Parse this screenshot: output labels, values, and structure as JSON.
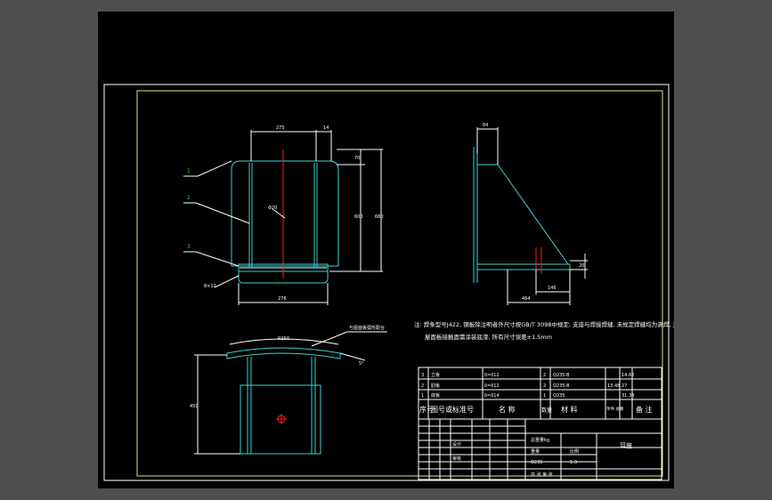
{
  "drawing": {
    "note_line1": "注: 焊条型号J422, 钢板除注明者外尺寸按GB/T 3098中规定, 支座与焊接焊缝, 未规定焊缝均为满焊,  支座与",
    "note_line2": "屋面板接触面需涂装底漆, 所有尺寸误差±1.5mm",
    "front_view": {
      "dim_top_left": "275",
      "dim_top_right": "14",
      "dim_right_small": "70",
      "dim_right_mid": "600",
      "dim_right_total": "680",
      "dim_bottom": "276",
      "label_center": "Φ20",
      "label_bottom_left": "8×12",
      "part_markers": [
        "1",
        "2",
        "3"
      ]
    },
    "side_view": {
      "dim_top": "64",
      "dim_right": "20",
      "dim_bottom_inner": "146",
      "dim_bottom": "464"
    },
    "plan_view": {
      "dim_arc": "R250",
      "label_leader": "与屋面板弧形配合",
      "dim_left": "450",
      "dim_angle": "5°"
    },
    "bom": {
      "rows": [
        {
          "no": "3",
          "name": "立板",
          "spec": "δ=δ12",
          "qty": "2",
          "material": "Q235-B",
          "unit_w": "",
          "total_w": "14.62"
        },
        {
          "no": "2",
          "name": "肋板",
          "spec": "δ=δ12",
          "qty": "2",
          "material": "Q235-B",
          "unit_w": "13.48",
          "total_w": "27"
        },
        {
          "no": "1",
          "name": "底板",
          "spec": "δ=δ14",
          "qty": "1",
          "material": "Q235",
          "unit_w": "",
          "total_w": "31.34"
        }
      ],
      "headers": {
        "no": "序号",
        "code": "图号或标准号",
        "name": "名  称",
        "qty": "数量",
        "material": "材  料",
        "weight": "单件  总重",
        "remark": "备 注"
      }
    },
    "title_block": {
      "title": "耳座",
      "scale_label": "比例",
      "scale_value": "1:3",
      "weight_label": "重量",
      "sheet_label": "共  张  第  张",
      "drawn_label": "设计",
      "checked_label": "审核",
      "material_cell": "Q235",
      "drawing_number": "总重量kg"
    }
  }
}
